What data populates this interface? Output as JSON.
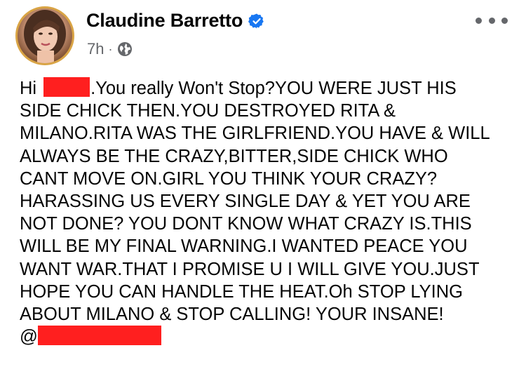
{
  "post": {
    "author": {
      "name": "Claudine Barretto",
      "verified": true
    },
    "meta": {
      "time": "7h",
      "separator": "·",
      "audience_icon": "globe-icon"
    },
    "more_icon": "more-options-icon",
    "redaction_color": "#ff1f1f",
    "text": {
      "greeting": "Hi",
      "line1_rest": ".You really Won't Stop?YOU WERE JUST HIS",
      "lines": [
        "SIDE CHICK THEN.YOU DESTROYED RITA &",
        "MILANO.RITA WAS THE GIRLFRIEND.YOU HAVE & WILL",
        "ALWAYS BE THE CRAZY,BITTER,SIDE CHICK WHO",
        "CANT MOVE ON.GIRL YOU THINK YOUR CRAZY?",
        "HARASSING US EVERY SINGLE DAY & YET YOU ARE",
        "NOT DONE? YOU DONT KNOW WHAT CRAZY IS.THIS",
        "WILL BE MY FINAL WARNING.I WANTED PEACE YOU",
        "WANT WAR.THAT I PROMISE U I WILL GIVE YOU.JUST",
        "HOPE YOU CAN HANDLE THE HEAT.Oh STOP LYING",
        "ABOUT MILANO & STOP CALLING! YOUR INSANE!"
      ],
      "mention_prefix": "@"
    }
  }
}
